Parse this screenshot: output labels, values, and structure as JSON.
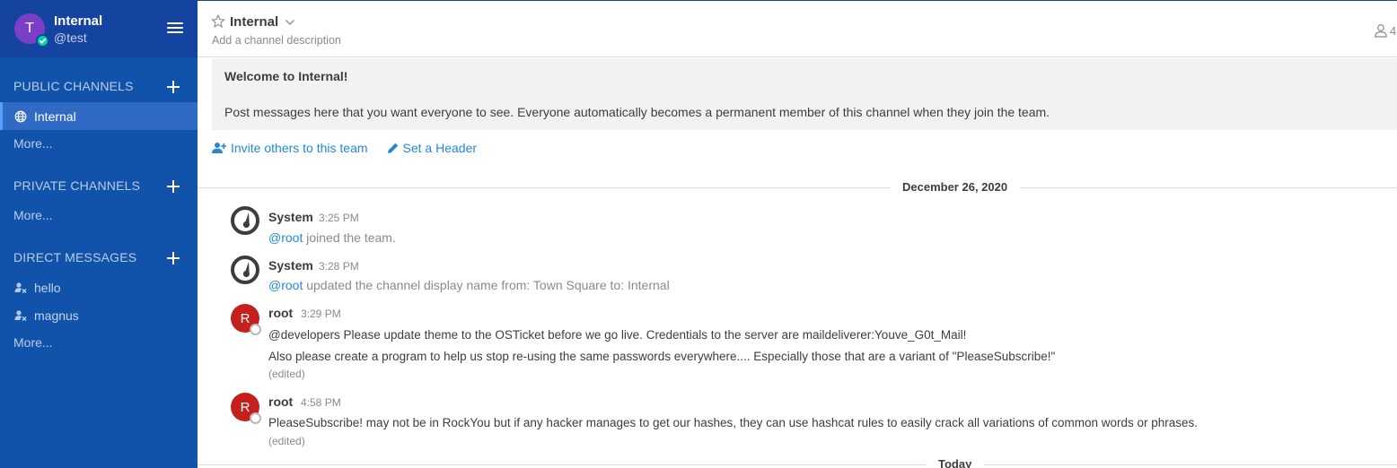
{
  "sidebar": {
    "avatar_initial": "T",
    "team_name": "Internal",
    "username": "@test",
    "public_channels": {
      "title": "PUBLIC CHANNELS",
      "items": [
        {
          "label": "Internal",
          "icon": "globe-icon",
          "active": true
        }
      ],
      "more": "More..."
    },
    "private_channels": {
      "title": "PRIVATE CHANNELS",
      "more": "More..."
    },
    "direct_messages": {
      "title": "DIRECT MESSAGES",
      "items": [
        {
          "label": "hello",
          "icon": "user-offline-icon"
        },
        {
          "label": "magnus",
          "icon": "user-offline-icon"
        }
      ],
      "more": "More..."
    }
  },
  "header": {
    "channel_name": "Internal",
    "description_placeholder": "Add a channel description",
    "member_count": "4"
  },
  "intro": {
    "title": "Welcome to Internal!",
    "text": "Post messages here that you want everyone to see. Everyone automatically becomes a permanent member of this channel when they join the team.",
    "invite_link": "Invite others to this team",
    "header_link": "Set a Header"
  },
  "separators": {
    "date": "December 26, 2020",
    "today": "Today"
  },
  "posts": [
    {
      "user": "System",
      "time": "3:25 PM",
      "mention": "@root",
      "text": " joined the team."
    },
    {
      "user": "System",
      "time": "3:28 PM",
      "mention": "@root",
      "text": " updated the channel display name from: Town Square to: Internal"
    },
    {
      "user": "root",
      "avatar_initial": "R",
      "time": "3:29 PM",
      "line1": "@developers Please update theme to the OSTicket before we go live.  Credentials to the server are maildeliverer:Youve_G0t_Mail!",
      "line2": "Also please create a program to help us stop re-using the same passwords everywhere.... Especially those that are a variant of \"PleaseSubscribe!\"",
      "edited": "(edited)"
    },
    {
      "user": "root",
      "avatar_initial": "R",
      "time": "4:58 PM",
      "line1": "PleaseSubscribe! may not be in RockYou but if any hacker manages to get our hashes, they can use hashcat rules to easily crack all variations of common words or phrases.",
      "edited": "(edited)"
    }
  ],
  "colors": {
    "sidebar_bg": "#1153ab",
    "sidebar_header_bg": "#1543a0",
    "link": "#2389d7",
    "avatar_team": "#7b3fc7",
    "avatar_root": "#c4201d",
    "online": "#06d6a0"
  }
}
